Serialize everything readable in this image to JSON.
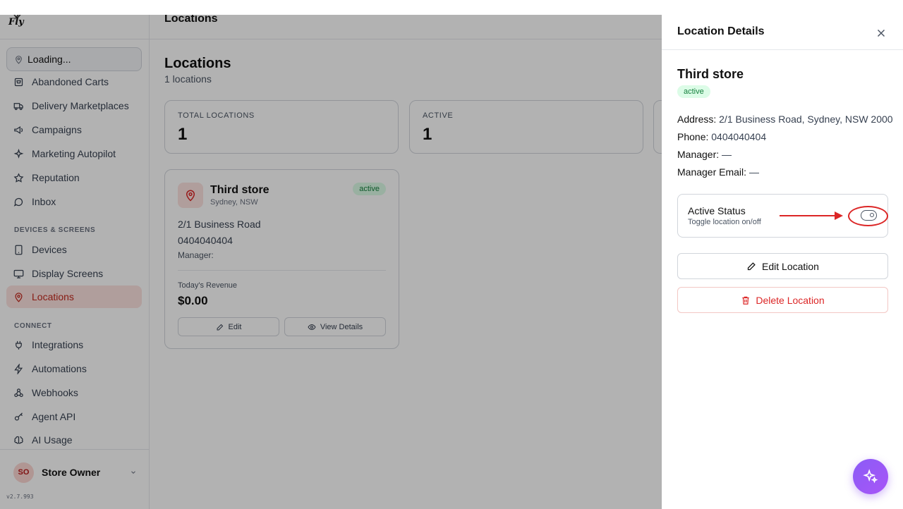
{
  "app": {
    "logo_text": "Fly",
    "version": "v2.7.993"
  },
  "sidebar": {
    "location_selector": "Loading...",
    "items": [
      {
        "label": "Abandoned Carts",
        "icon": "cart-icon"
      },
      {
        "label": "Delivery Marketplaces",
        "icon": "truck-icon"
      },
      {
        "label": "Campaigns",
        "icon": "megaphone-icon"
      },
      {
        "label": "Marketing Autopilot",
        "icon": "sparkle-icon"
      },
      {
        "label": "Reputation",
        "icon": "star-icon"
      },
      {
        "label": "Inbox",
        "icon": "chat-icon"
      }
    ],
    "section_devices": "DEVICES & SCREENS",
    "devices_items": [
      {
        "label": "Devices",
        "icon": "tablet-icon"
      },
      {
        "label": "Display Screens",
        "icon": "monitor-icon"
      },
      {
        "label": "Locations",
        "icon": "map-pin-icon",
        "active": true
      }
    ],
    "section_connect": "CONNECT",
    "connect_items": [
      {
        "label": "Integrations",
        "icon": "plug-icon"
      },
      {
        "label": "Automations",
        "icon": "zap-icon"
      },
      {
        "label": "Webhooks",
        "icon": "webhook-icon"
      },
      {
        "label": "Agent API",
        "icon": "key-icon"
      },
      {
        "label": "AI Usage",
        "icon": "brain-icon"
      }
    ],
    "user": {
      "initials": "SO",
      "name": "Store Owner"
    }
  },
  "topbar": {
    "title": "Locations"
  },
  "main": {
    "title": "Locations",
    "subtitle": "1 locations",
    "stats": [
      {
        "label": "TOTAL LOCATIONS",
        "value": "1"
      },
      {
        "label": "ACTIVE",
        "value": "1"
      }
    ],
    "location_card": {
      "name": "Third store",
      "city": "Sydney, NSW",
      "status": "active",
      "address": "2/1 Business Road",
      "phone": "0404040404",
      "manager_label": "Manager:",
      "revenue_label": "Today's Revenue",
      "revenue": "$0.00",
      "edit_label": "Edit",
      "view_label": "View Details"
    }
  },
  "drawer": {
    "title": "Location Details",
    "name": "Third store",
    "status": "active",
    "address_label": "Address:",
    "address": "2/1 Business Road, Sydney, NSW 2000",
    "phone_label": "Phone:",
    "phone": "0404040404",
    "manager_label": "Manager:",
    "manager": "—",
    "manager_email_label": "Manager Email:",
    "manager_email": "—",
    "toggle": {
      "title": "Active Status",
      "subtitle": "Toggle location on/off",
      "on": true
    },
    "edit_button": "Edit Location",
    "delete_button": "Delete Location"
  },
  "colors": {
    "accent": "#dc2626",
    "active_badge_bg": "#dcfce7",
    "fab": "#8b5cf6"
  }
}
